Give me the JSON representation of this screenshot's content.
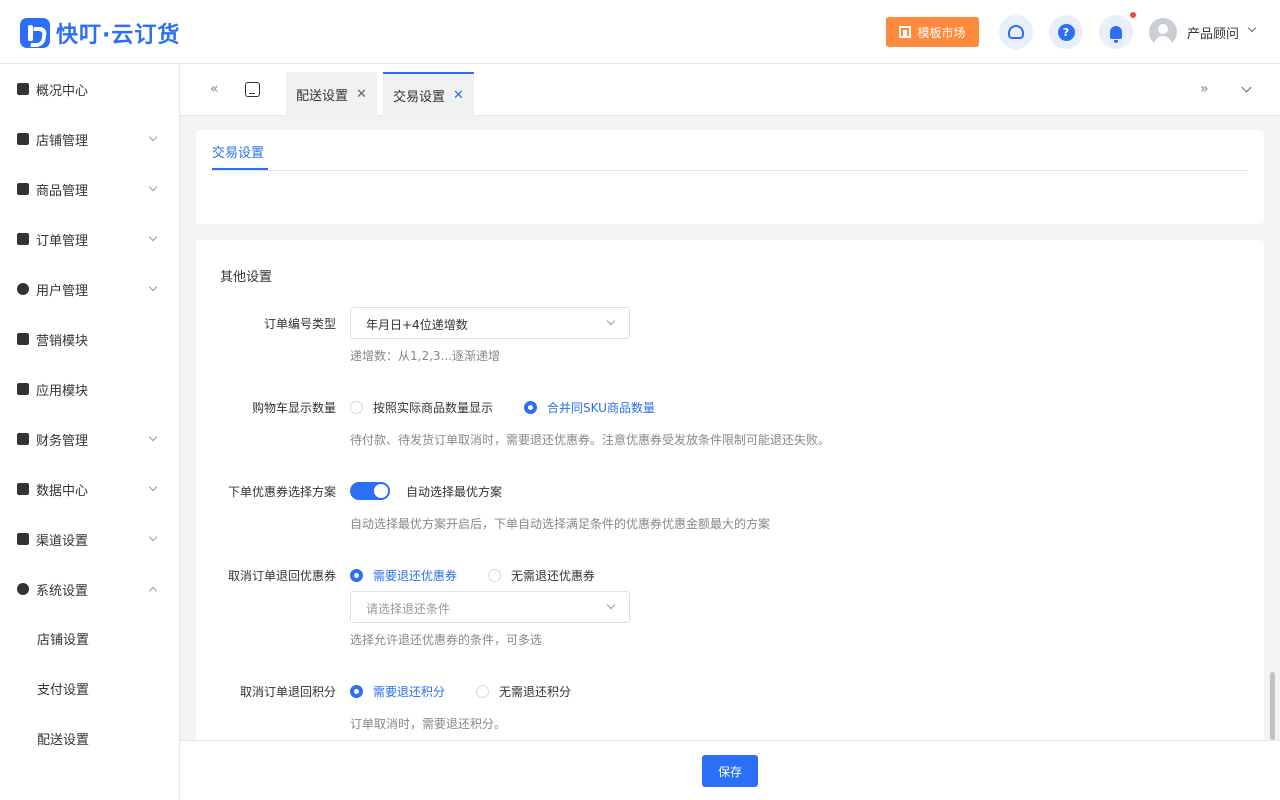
{
  "app": {
    "name": "快叮·云订货"
  },
  "header": {
    "template_market": "模板市场",
    "user_name": "产品顾问"
  },
  "sidebar": {
    "items": [
      {
        "label": "概况中心",
        "icon": "dashboard-icon",
        "expandable": false
      },
      {
        "label": "店铺管理",
        "icon": "store-icon",
        "expandable": true
      },
      {
        "label": "商品管理",
        "icon": "goods-icon",
        "expandable": true
      },
      {
        "label": "订单管理",
        "icon": "order-icon",
        "expandable": true
      },
      {
        "label": "用户管理",
        "icon": "user-icon",
        "expandable": true
      },
      {
        "label": "营销模块",
        "icon": "marketing-icon",
        "expandable": false
      },
      {
        "label": "应用模块",
        "icon": "apps-icon",
        "expandable": false
      },
      {
        "label": "财务管理",
        "icon": "wallet-icon",
        "expandable": true
      },
      {
        "label": "数据中心",
        "icon": "chart-icon",
        "expandable": true
      },
      {
        "label": "渠道设置",
        "icon": "channel-icon",
        "expandable": true
      },
      {
        "label": "系统设置",
        "icon": "gear-icon",
        "expandable": true,
        "expanded": true
      }
    ],
    "sub_items": [
      "店铺设置",
      "支付设置",
      "配送设置"
    ]
  },
  "tabs": [
    {
      "label": "配送设置",
      "active": false
    },
    {
      "label": "交易设置",
      "active": true
    }
  ],
  "page_tab": "交易设置",
  "form": {
    "section_title": "其他设置",
    "order_number_type": {
      "label": "订单编号类型",
      "value": "年月日+4位递增数",
      "hint": "递增数：从1,2,3...逐渐递增"
    },
    "cart_display": {
      "label": "购物车显示数量",
      "options": [
        "按照实际商品数量显示",
        "合并同SKU商品数量"
      ],
      "selected": 1,
      "hint": "待付款、待发货订单取消时，需要退还优惠券。注意优惠券受发放条件限制可能退还失败。"
    },
    "coupon_scheme": {
      "label": "下单优惠券选择方案",
      "switch_on": true,
      "switch_label": "自动选择最优方案",
      "hint": "自动选择最优方案开启后，下单自动选择满足条件的优惠券优惠金额最大的方案"
    },
    "cancel_return_coupon": {
      "label": "取消订单退回优惠券",
      "options": [
        "需要退还优惠券",
        "无需退还优惠券"
      ],
      "selected": 0,
      "select_placeholder": "请选择退还条件",
      "hint": "选择允许退还优惠券的条件，可多选"
    },
    "cancel_return_points": {
      "label": "取消订单退回积分",
      "options": [
        "需要退还积分",
        "无需退还积分"
      ],
      "selected": 0,
      "hint": "订单取消时，需要退还积分。"
    }
  },
  "footer": {
    "save_label": "保存"
  },
  "colors": {
    "primary": "#2a6ff5",
    "template_button": "#ff8a3d",
    "notification_dot": "#f04848"
  }
}
